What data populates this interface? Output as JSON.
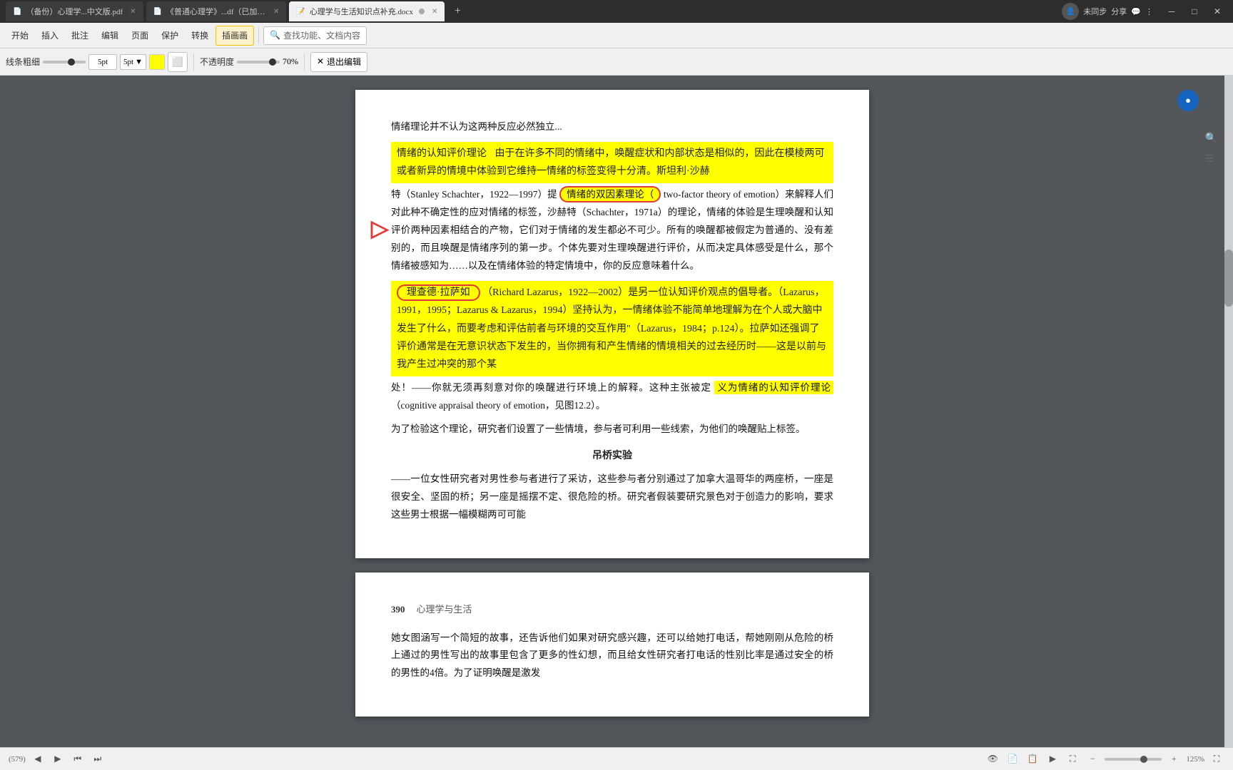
{
  "titleBar": {
    "tabs": [
      {
        "id": "tab1",
        "label": "（备份）心理学...中文版.pdf",
        "icon": "📄",
        "active": false
      },
      {
        "id": "tab2",
        "label": "《普通心理学》...df（已加密）",
        "icon": "📄",
        "active": false
      },
      {
        "id": "tab3",
        "label": "心理学与生活知识点补充.docx",
        "icon": "📝",
        "active": true
      }
    ],
    "addTabLabel": "+",
    "controls": {
      "minimize": "─",
      "maximize": "□",
      "close": "✕"
    }
  },
  "menuBar": {
    "items": [
      "开始",
      "插入",
      "批注",
      "编辑",
      "页面",
      "保护",
      "转换",
      "插画画"
    ],
    "search": "查找功能、文档内容"
  },
  "drawToolbar": {
    "lineLabel": "线条粗细",
    "sizeValue": "5pt",
    "transparencyLabel": "不透明度",
    "transparencyValue": "70%",
    "exitLabel": "退出编辑"
  },
  "pageContent": {
    "introText": "情绪理论并不认为这两种反应必然独立...",
    "section1": {
      "heading": "情绪的认知评价理论",
      "text1": "由于在许多不同的情绪中，唤醒症状和内部状态是相似的，因此在模棱两可或者新异的情境中体验到它维持一情绪的标签变得十分清。斯坦利·沙赫特（Stanley Schachter，1922—1997）提",
      "highlight1": "情绪的双因素理论（",
      "text2": "two-factor theory of emotion）来解释人们对此种不确定性的应对情绪的标签，沙赫特（Schachter，1971a）的理论，情绪的体验是生理唤醒和认知评价两种因素相结合的产物，它们对于情绪的发生都必不可少。所有的唤醒都被假定为普通的、没有差别的，而且唤醒是情绪序列的第一步。个体先要对生理唤醒进行评价，从而决定具体感受是什么，那个情绪被感知为……以及在情绪体验的特定情境中，你的反应意味着什么。"
    },
    "section2": {
      "circleText": "理查德·拉萨如",
      "text1": "Richard Lazarus，1922—2002）是另一位认知评价观点的倡导者。（Lazarus，1991，1995；Lazarus & Lazarus，1994）坚持认为，一情绪体验不能简单地理解为在个人或大脑中发生了什么，而要考虑和评估前者与环境的交互作用\"（Lazarus，1984；p.124）。拉萨如还强调了评价通常是在无意识状态下发生的，当你拥有和产生情绪的情境相关的过去经历时——这是以前与我产生过冲突的那个某处！——你就无须再刻意对你的唤醒进行环境上的解释。这种主张被定",
      "highlight2": "义为情绪的认知评价理论",
      "text2": "（cognitive appraisal theory of emotion，见图12.2）。"
    },
    "experiment": {
      "title": "吊桥实验",
      "text": "为了检验这个理论，研究者们设置了一些情境，参与者可利用一些线索，为他们的唤醒贴上标签。",
      "content": "——一位女性研究者对男性参与者进行了采访，这些参与者分别通过了加拿大温哥华的两座桥，一座是很安全、坚固的桥；另一座是摇摆不定、很危险的桥。研究者假装要研究景色对于创造力的影响，要求这些男士根据一幅模糊两可可能"
    },
    "page2": {
      "pageNum": "390",
      "title": "心理学与生活",
      "text": "她女图涵写一个简短的故事，还告诉他们如果对研究感兴趣，还可以给她打电话，帮她刚刚从危险的桥上通过的男性写出的故事里包含了更多的性幻想，而且给女性研究者打电话的性别比率是通过安全的桥的男性的4倍。为了证明唤醒是激发"
    }
  },
  "bottomBar": {
    "pageInfo": "(579)",
    "prevPage": "◀",
    "nextPage": "▶",
    "zoomValue": "125%",
    "zoomIn": "+",
    "zoomOut": "−"
  },
  "topBarRight": {
    "syncLabel": "未同步",
    "shareLabel": "分享"
  }
}
